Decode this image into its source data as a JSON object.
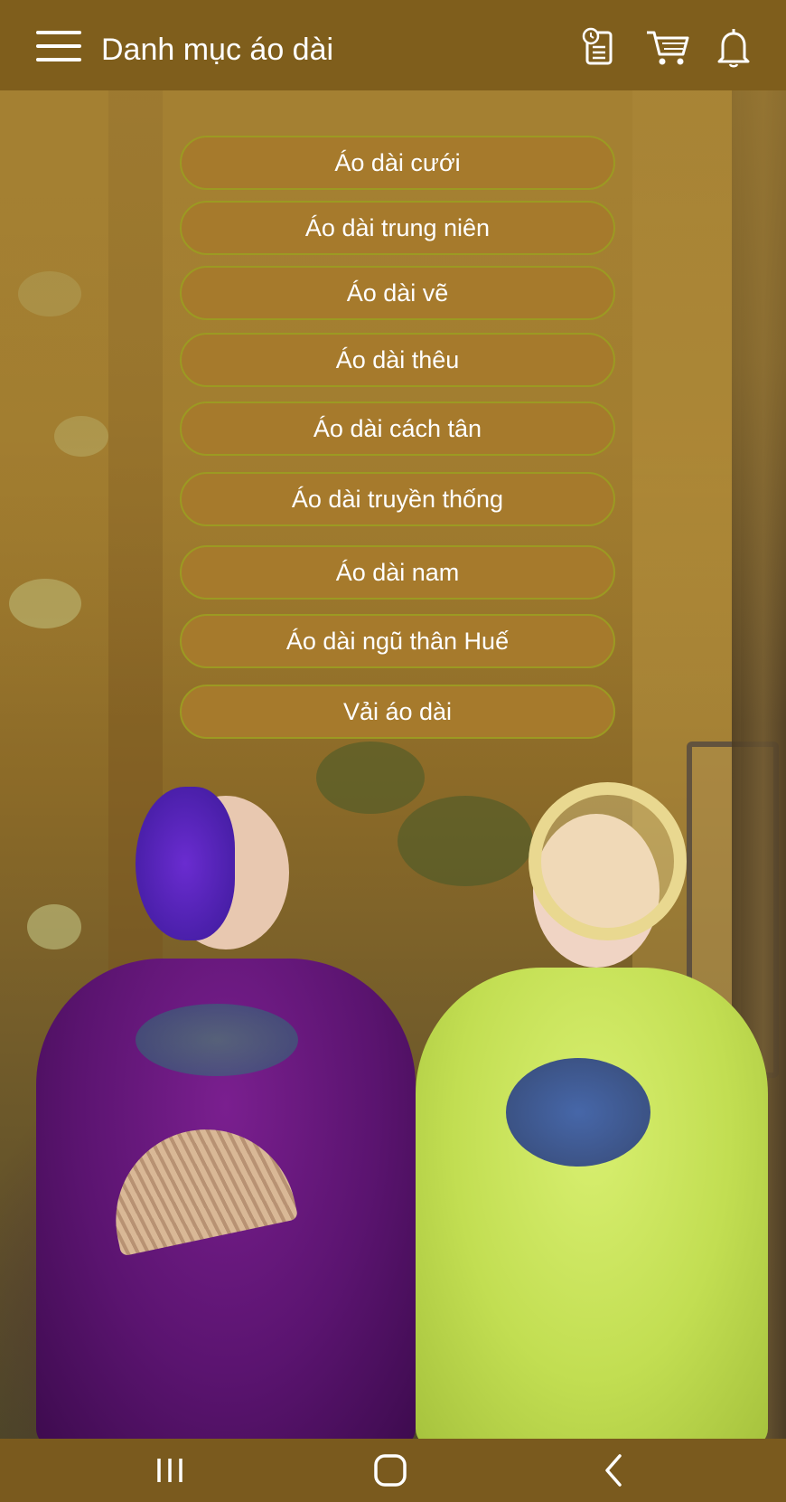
{
  "header": {
    "title": "Danh mục áo dài",
    "icons": [
      "menu-icon",
      "clipboard-clock-icon",
      "cart-icon",
      "bell-icon"
    ]
  },
  "categories": [
    "Áo dài cưới",
    "Áo dài trung niên",
    "Áo dài vẽ",
    "Áo dài thêu",
    "Áo dài cách tân",
    "Áo dài truyền thống",
    "Áo dài nam",
    "Áo dài ngũ thân Huế",
    "Vải áo dài"
  ],
  "navbar": {
    "icons": [
      "recent-apps-icon",
      "home-icon",
      "back-icon"
    ]
  },
  "colors": {
    "header_bg": "#7f5e1c",
    "button_bg": "#a67a2c",
    "button_border": "#9c9a22",
    "text": "#ffffff"
  }
}
